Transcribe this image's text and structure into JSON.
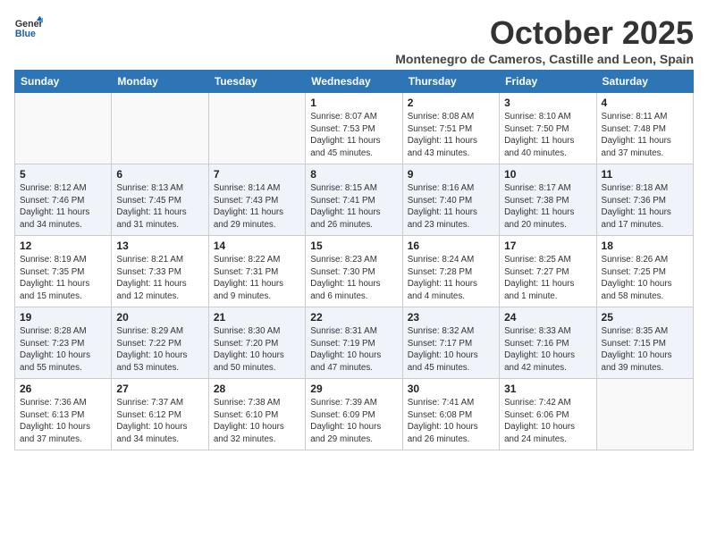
{
  "header": {
    "logo_line1": "General",
    "logo_line2": "Blue",
    "title": "October 2025",
    "subtitle": "Montenegro de Cameros, Castille and Leon, Spain"
  },
  "columns": [
    "Sunday",
    "Monday",
    "Tuesday",
    "Wednesday",
    "Thursday",
    "Friday",
    "Saturday"
  ],
  "weeks": [
    [
      {
        "day": "",
        "info": ""
      },
      {
        "day": "",
        "info": ""
      },
      {
        "day": "",
        "info": ""
      },
      {
        "day": "1",
        "info": "Sunrise: 8:07 AM\nSunset: 7:53 PM\nDaylight: 11 hours\nand 45 minutes."
      },
      {
        "day": "2",
        "info": "Sunrise: 8:08 AM\nSunset: 7:51 PM\nDaylight: 11 hours\nand 43 minutes."
      },
      {
        "day": "3",
        "info": "Sunrise: 8:10 AM\nSunset: 7:50 PM\nDaylight: 11 hours\nand 40 minutes."
      },
      {
        "day": "4",
        "info": "Sunrise: 8:11 AM\nSunset: 7:48 PM\nDaylight: 11 hours\nand 37 minutes."
      }
    ],
    [
      {
        "day": "5",
        "info": "Sunrise: 8:12 AM\nSunset: 7:46 PM\nDaylight: 11 hours\nand 34 minutes."
      },
      {
        "day": "6",
        "info": "Sunrise: 8:13 AM\nSunset: 7:45 PM\nDaylight: 11 hours\nand 31 minutes."
      },
      {
        "day": "7",
        "info": "Sunrise: 8:14 AM\nSunset: 7:43 PM\nDaylight: 11 hours\nand 29 minutes."
      },
      {
        "day": "8",
        "info": "Sunrise: 8:15 AM\nSunset: 7:41 PM\nDaylight: 11 hours\nand 26 minutes."
      },
      {
        "day": "9",
        "info": "Sunrise: 8:16 AM\nSunset: 7:40 PM\nDaylight: 11 hours\nand 23 minutes."
      },
      {
        "day": "10",
        "info": "Sunrise: 8:17 AM\nSunset: 7:38 PM\nDaylight: 11 hours\nand 20 minutes."
      },
      {
        "day": "11",
        "info": "Sunrise: 8:18 AM\nSunset: 7:36 PM\nDaylight: 11 hours\nand 17 minutes."
      }
    ],
    [
      {
        "day": "12",
        "info": "Sunrise: 8:19 AM\nSunset: 7:35 PM\nDaylight: 11 hours\nand 15 minutes."
      },
      {
        "day": "13",
        "info": "Sunrise: 8:21 AM\nSunset: 7:33 PM\nDaylight: 11 hours\nand 12 minutes."
      },
      {
        "day": "14",
        "info": "Sunrise: 8:22 AM\nSunset: 7:31 PM\nDaylight: 11 hours\nand 9 minutes."
      },
      {
        "day": "15",
        "info": "Sunrise: 8:23 AM\nSunset: 7:30 PM\nDaylight: 11 hours\nand 6 minutes."
      },
      {
        "day": "16",
        "info": "Sunrise: 8:24 AM\nSunset: 7:28 PM\nDaylight: 11 hours\nand 4 minutes."
      },
      {
        "day": "17",
        "info": "Sunrise: 8:25 AM\nSunset: 7:27 PM\nDaylight: 11 hours\nand 1 minute."
      },
      {
        "day": "18",
        "info": "Sunrise: 8:26 AM\nSunset: 7:25 PM\nDaylight: 10 hours\nand 58 minutes."
      }
    ],
    [
      {
        "day": "19",
        "info": "Sunrise: 8:28 AM\nSunset: 7:23 PM\nDaylight: 10 hours\nand 55 minutes."
      },
      {
        "day": "20",
        "info": "Sunrise: 8:29 AM\nSunset: 7:22 PM\nDaylight: 10 hours\nand 53 minutes."
      },
      {
        "day": "21",
        "info": "Sunrise: 8:30 AM\nSunset: 7:20 PM\nDaylight: 10 hours\nand 50 minutes."
      },
      {
        "day": "22",
        "info": "Sunrise: 8:31 AM\nSunset: 7:19 PM\nDaylight: 10 hours\nand 47 minutes."
      },
      {
        "day": "23",
        "info": "Sunrise: 8:32 AM\nSunset: 7:17 PM\nDaylight: 10 hours\nand 45 minutes."
      },
      {
        "day": "24",
        "info": "Sunrise: 8:33 AM\nSunset: 7:16 PM\nDaylight: 10 hours\nand 42 minutes."
      },
      {
        "day": "25",
        "info": "Sunrise: 8:35 AM\nSunset: 7:15 PM\nDaylight: 10 hours\nand 39 minutes."
      }
    ],
    [
      {
        "day": "26",
        "info": "Sunrise: 7:36 AM\nSunset: 6:13 PM\nDaylight: 10 hours\nand 37 minutes."
      },
      {
        "day": "27",
        "info": "Sunrise: 7:37 AM\nSunset: 6:12 PM\nDaylight: 10 hours\nand 34 minutes."
      },
      {
        "day": "28",
        "info": "Sunrise: 7:38 AM\nSunset: 6:10 PM\nDaylight: 10 hours\nand 32 minutes."
      },
      {
        "day": "29",
        "info": "Sunrise: 7:39 AM\nSunset: 6:09 PM\nDaylight: 10 hours\nand 29 minutes."
      },
      {
        "day": "30",
        "info": "Sunrise: 7:41 AM\nSunset: 6:08 PM\nDaylight: 10 hours\nand 26 minutes."
      },
      {
        "day": "31",
        "info": "Sunrise: 7:42 AM\nSunset: 6:06 PM\nDaylight: 10 hours\nand 24 minutes."
      },
      {
        "day": "",
        "info": ""
      }
    ]
  ]
}
